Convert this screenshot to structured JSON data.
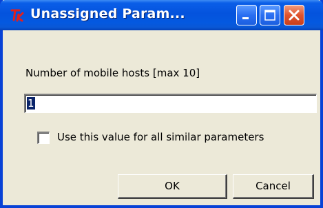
{
  "window": {
    "title": "Unassigned Param...",
    "app_icon": "tk-feather-icon",
    "controls": {
      "minimize_icon": "minimize-icon",
      "maximize_icon": "maximize-icon",
      "close_icon": "close-icon"
    }
  },
  "form": {
    "label": "Number of mobile hosts [max 10]",
    "value": "1",
    "checkbox_label": "Use this value for all similar parameters",
    "checkbox_checked": false
  },
  "buttons": {
    "ok_label": "OK",
    "cancel_label": "Cancel"
  },
  "colors": {
    "titlebar": "#0453dd",
    "window_bg": "#ece9d8",
    "close_button": "#e0532d"
  }
}
